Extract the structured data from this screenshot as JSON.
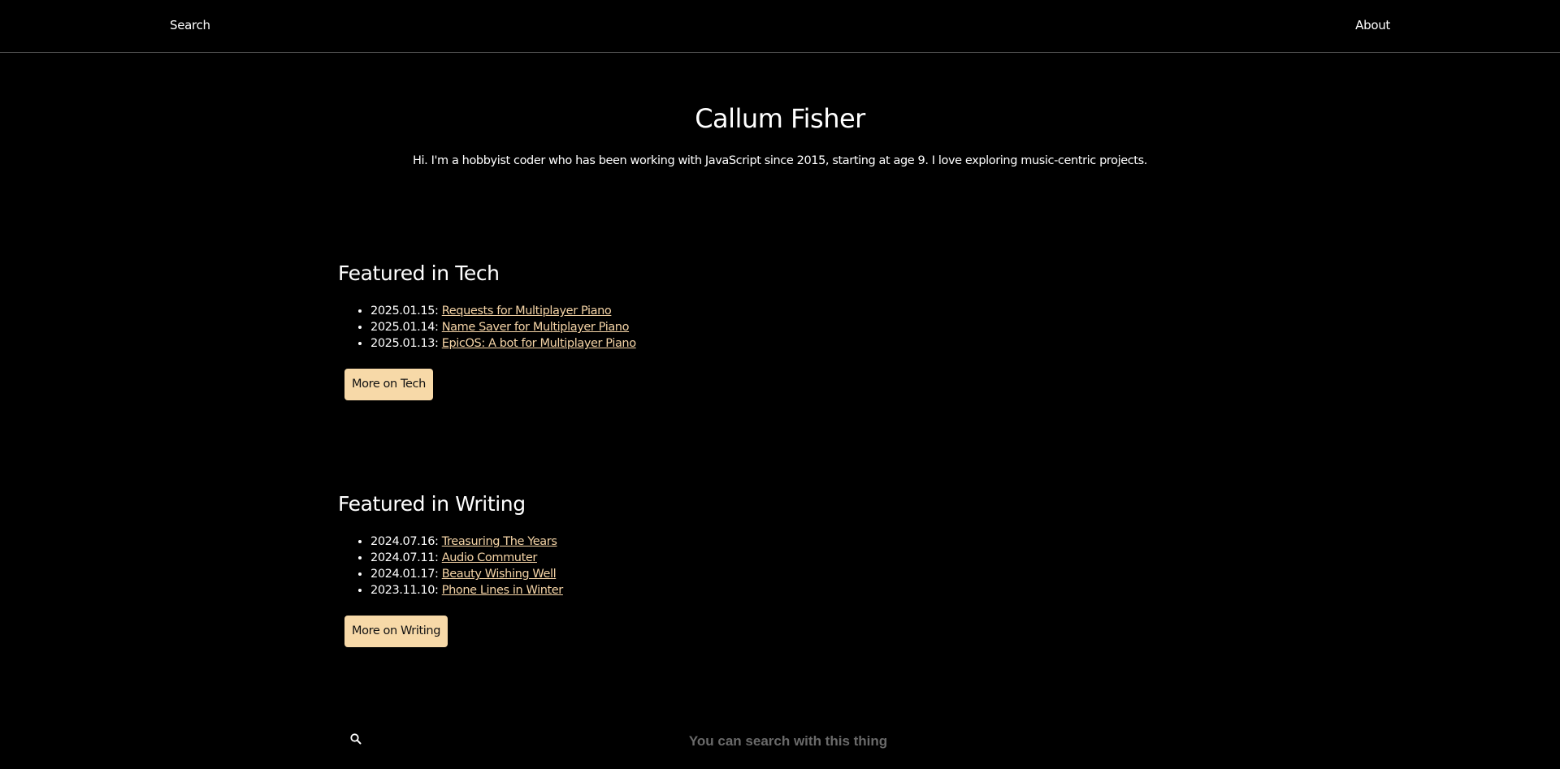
{
  "nav": {
    "search_label": "Search",
    "about_label": "About"
  },
  "hero": {
    "title": "Callum Fisher",
    "subtitle": "Hi. I'm a hobbyist coder who has been working with JavaScript since 2015, starting at age 9. I love exploring music-centric projects."
  },
  "tech": {
    "heading": "Featured in Tech",
    "posts": [
      {
        "date": "2025.01.15:",
        "title": "Requests for Multiplayer Piano"
      },
      {
        "date": "2025.01.14:",
        "title": "Name Saver for Multiplayer Piano"
      },
      {
        "date": "2025.01.13:",
        "title": "EpicOS: A bot for Multiplayer Piano"
      }
    ],
    "more_label": "More on Tech"
  },
  "writing": {
    "heading": "Featured in Writing",
    "posts": [
      {
        "date": "2024.07.16:",
        "title": "Treasuring The Years"
      },
      {
        "date": "2024.07.11:",
        "title": "Audio Commuter"
      },
      {
        "date": "2024.01.17:",
        "title": "Beauty Wishing Well"
      },
      {
        "date": "2023.11.10:",
        "title": "Phone Lines in Winter"
      }
    ],
    "more_label": "More on Writing"
  },
  "search": {
    "placeholder": "You can search with this thing",
    "icon": "search-icon"
  },
  "colors": {
    "background": "#000000",
    "link": "#f5d4a6",
    "button": "#f7d9a8"
  }
}
